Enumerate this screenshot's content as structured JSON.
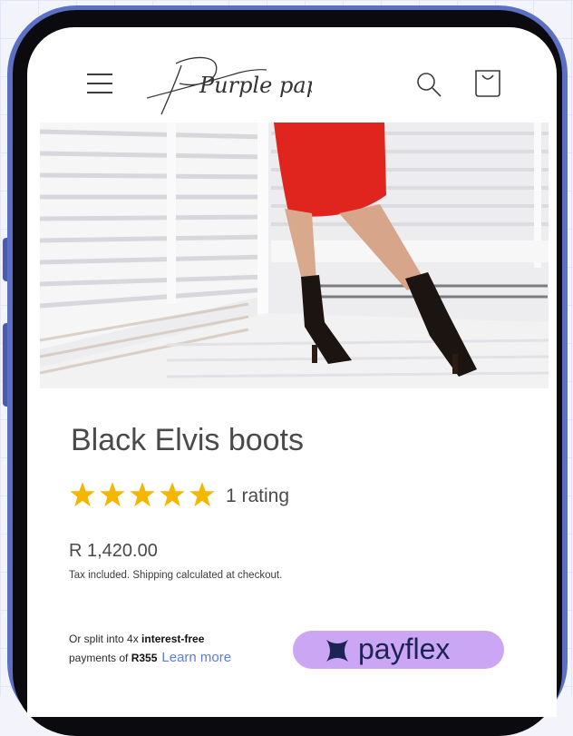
{
  "brand": {
    "logo_text": "Purple paper",
    "accent": "#cba6f4",
    "phone_frame": "#5b6fc4"
  },
  "header": {
    "menu_icon": "hamburger-menu-icon",
    "search_icon": "search-icon",
    "cart_icon": "shopping-bag-icon"
  },
  "product": {
    "title": "Black Elvis boots",
    "rating_stars": 5,
    "rating_text": "1 rating",
    "price": "R 1,420.00",
    "tax_note": "Tax included. Shipping calculated at checkout."
  },
  "payflex": {
    "line1_prefix": "Or split into 4x ",
    "line1_bold": "interest-free",
    "line2_prefix": "payments of ",
    "line2_amount": "R355",
    "learn_more": "Learn more",
    "badge_text": "payflex",
    "badge_color": "#cba6f4"
  }
}
